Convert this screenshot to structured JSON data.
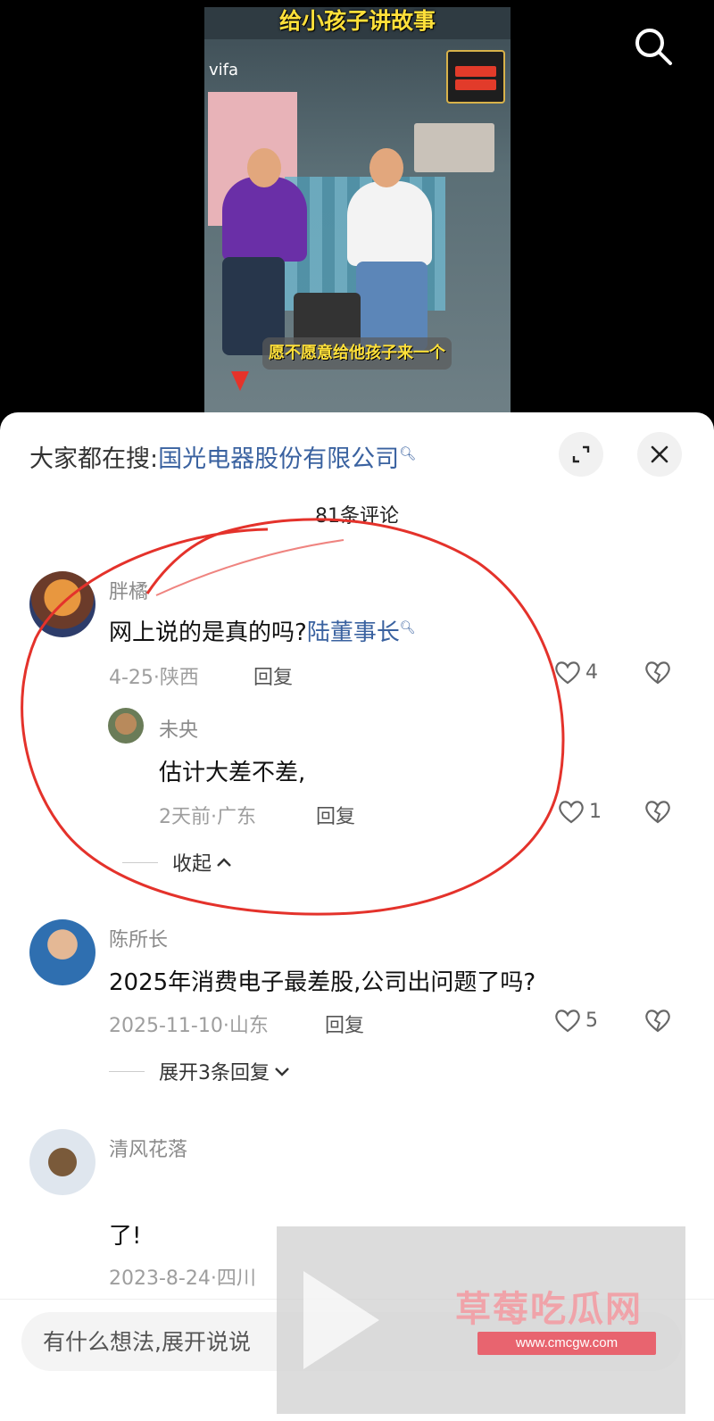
{
  "video": {
    "title": "给小孩子讲故事",
    "watermark": "vifa",
    "caption": "愿不愿意给他孩子来一个"
  },
  "header": {
    "trending_label": "大家都在搜:",
    "trending_link": "国光电器股份有限公司",
    "count": "81条评论"
  },
  "comments": [
    {
      "user": "胖橘",
      "text": "网上说的是真的吗?",
      "link": "陆董事长",
      "meta": "4-25·陕西",
      "reply_label": "回复",
      "likes": "4",
      "replies": [
        {
          "user": "未央",
          "text": "估计大差不差,",
          "meta": "2天前·广东",
          "reply_label": "回复",
          "likes": "1"
        }
      ],
      "toggle": "收起"
    },
    {
      "user": "陈所长",
      "text": "2025年消费电子最差股,公司出问题了吗?",
      "meta": "2025-11-10·山东",
      "reply_label": "回复",
      "likes": "5",
      "toggle": "展开3条回复"
    },
    {
      "user": "清风花落",
      "text": "了!",
      "meta": "2023-8-24·四川"
    }
  ],
  "input": {
    "placeholder": "有什么想法,展开说说"
  },
  "overlay_watermark": {
    "title": "草莓吃瓜网",
    "url": "www.cmcgw.com"
  },
  "colors": {
    "link": "#3a62a0",
    "annotation_ring": "#e4322b",
    "caption_yellow": "#ffe03a"
  },
  "icons": [
    "search-icon",
    "expand-icon",
    "close-icon",
    "heart-icon",
    "broken-heart-icon",
    "chevron-up-icon",
    "chevron-down-icon",
    "play-icon"
  ]
}
